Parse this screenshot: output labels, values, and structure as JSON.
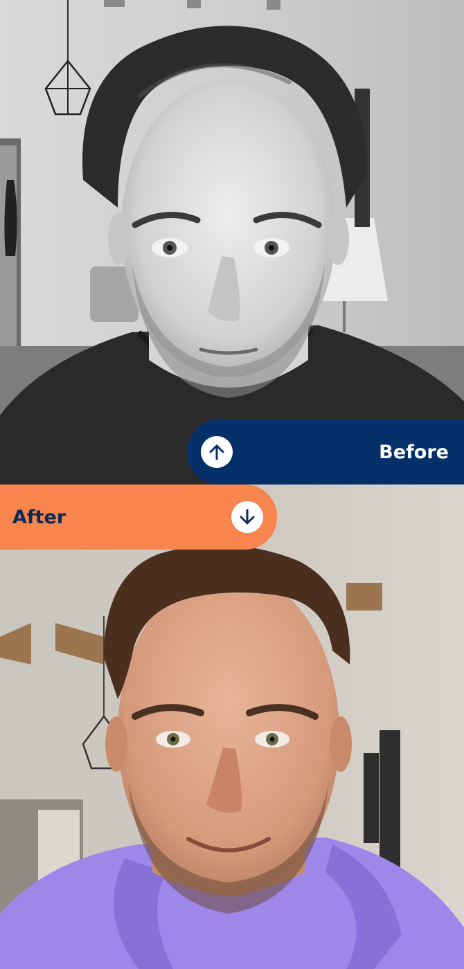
{
  "before": {
    "label": "Before",
    "icon": "arrow-up-icon",
    "color": "#052f69"
  },
  "after": {
    "label": "After",
    "icon": "arrow-down-icon",
    "color": "#f7854d"
  }
}
